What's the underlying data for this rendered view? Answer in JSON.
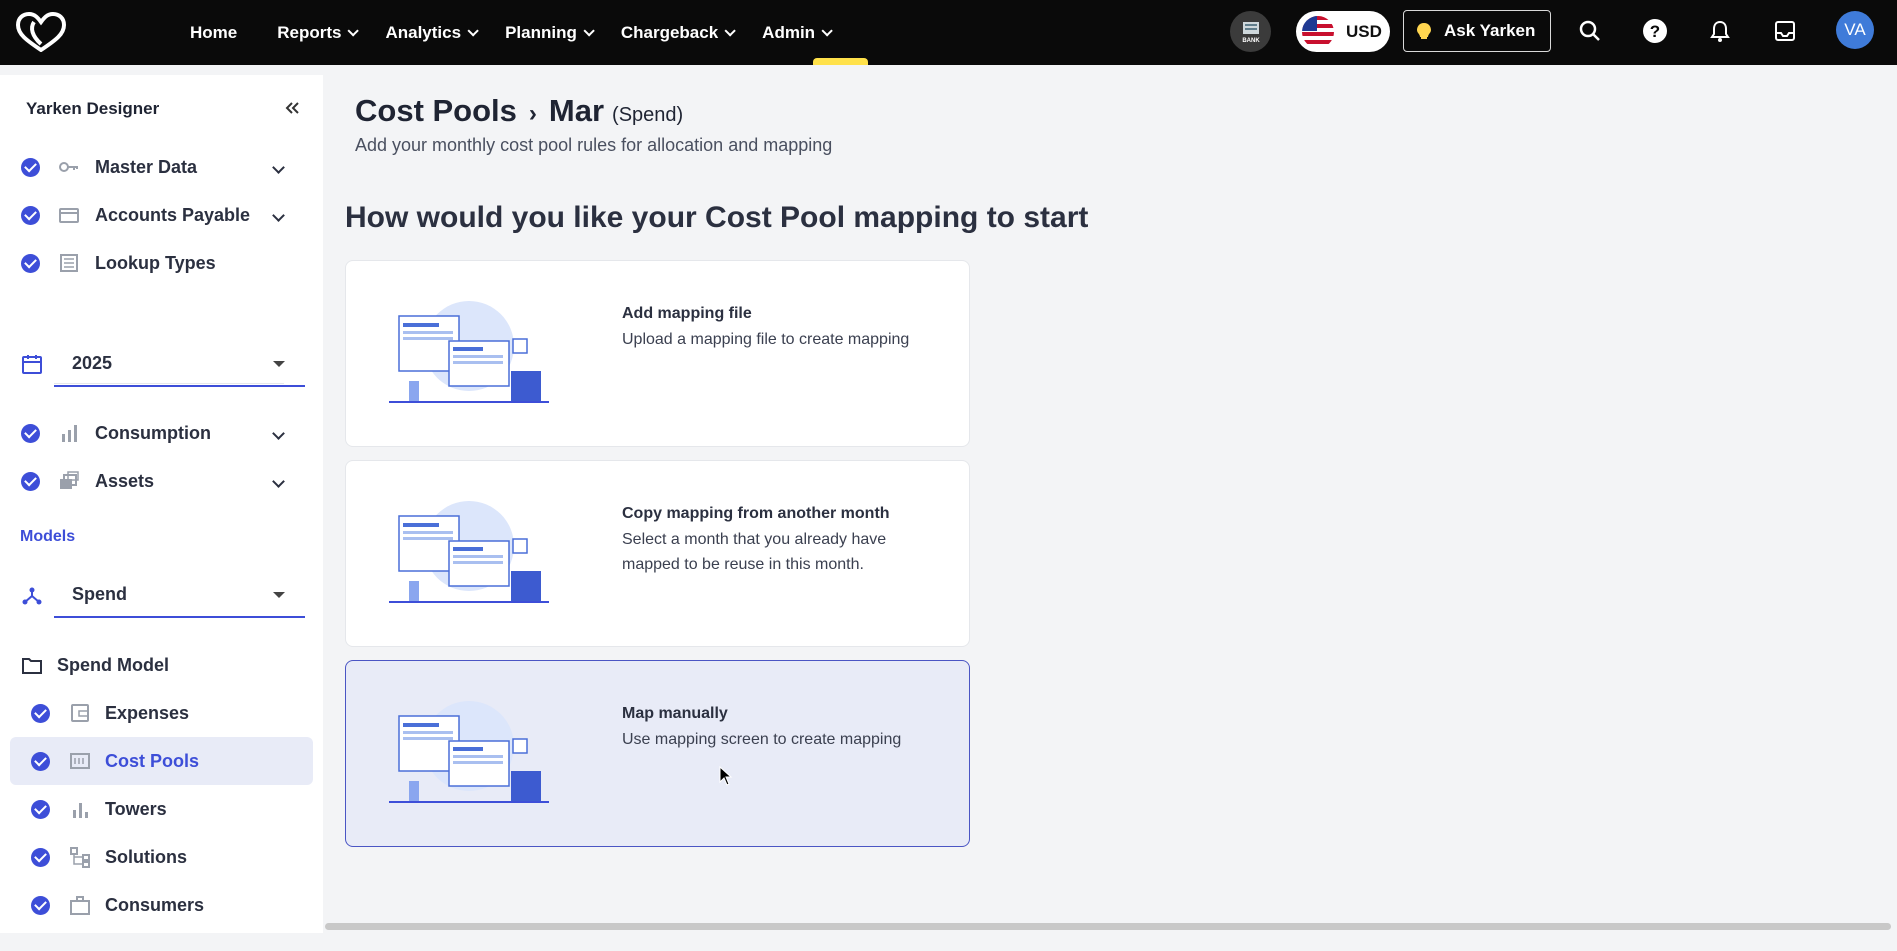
{
  "nav": {
    "items": [
      {
        "label": "Home",
        "has_dropdown": false
      },
      {
        "label": "Reports",
        "has_dropdown": true
      },
      {
        "label": "Analytics",
        "has_dropdown": true
      },
      {
        "label": "Planning",
        "has_dropdown": true
      },
      {
        "label": "Chargeback",
        "has_dropdown": true
      },
      {
        "label": "Admin",
        "has_dropdown": true
      }
    ],
    "active": "Admin",
    "bank_label": "BANK",
    "currency": "USD",
    "ask_label": "Ask Yarken",
    "avatar_initials": "VA",
    "accent_color": "#ffe14a"
  },
  "sidebar": {
    "title": "Yarken Designer",
    "top_items": [
      {
        "label": "Master Data",
        "icon": "key-icon",
        "expandable": true
      },
      {
        "label": "Accounts Payable",
        "icon": "credit-card-icon",
        "expandable": true
      },
      {
        "label": "Lookup Types",
        "icon": "list-icon",
        "expandable": false
      }
    ],
    "year": "2025",
    "mid_items": [
      {
        "label": "Consumption",
        "icon": "bar-chart-icon",
        "expandable": true
      },
      {
        "label": "Assets",
        "icon": "layers-icon",
        "expandable": true
      }
    ],
    "models_label": "Models",
    "model_select": "Spend",
    "model_group": "Spend Model",
    "model_items": [
      {
        "label": "Expenses",
        "icon": "wallet-icon",
        "selected": false
      },
      {
        "label": "Cost Pools",
        "icon": "grid-icon",
        "selected": true
      },
      {
        "label": "Towers",
        "icon": "bar-chart-icon",
        "selected": false
      },
      {
        "label": "Solutions",
        "icon": "hierarchy-icon",
        "selected": false
      },
      {
        "label": "Consumers",
        "icon": "briefcase-icon",
        "selected": false
      }
    ]
  },
  "main": {
    "breadcrumb": {
      "root": "Cost Pools",
      "current": "Mar",
      "tag": "(Spend)"
    },
    "subtitle": "Add your monthly cost pool rules for allocation and mapping",
    "question": "How would you like your Cost Pool mapping to start",
    "options": [
      {
        "title": "Add mapping file",
        "description": "Upload a mapping file to create mapping",
        "active": false
      },
      {
        "title": "Copy mapping from another month",
        "description": "Select a month that you already have mapped to be reuse in this month.",
        "active": false
      },
      {
        "title": "Map manually",
        "description": "Use mapping screen to create mapping",
        "active": true
      }
    ]
  },
  "colors": {
    "primary": "#3d4ed8",
    "selected_bg": "#e8ebf7",
    "topbar": "#0a0a0a"
  }
}
